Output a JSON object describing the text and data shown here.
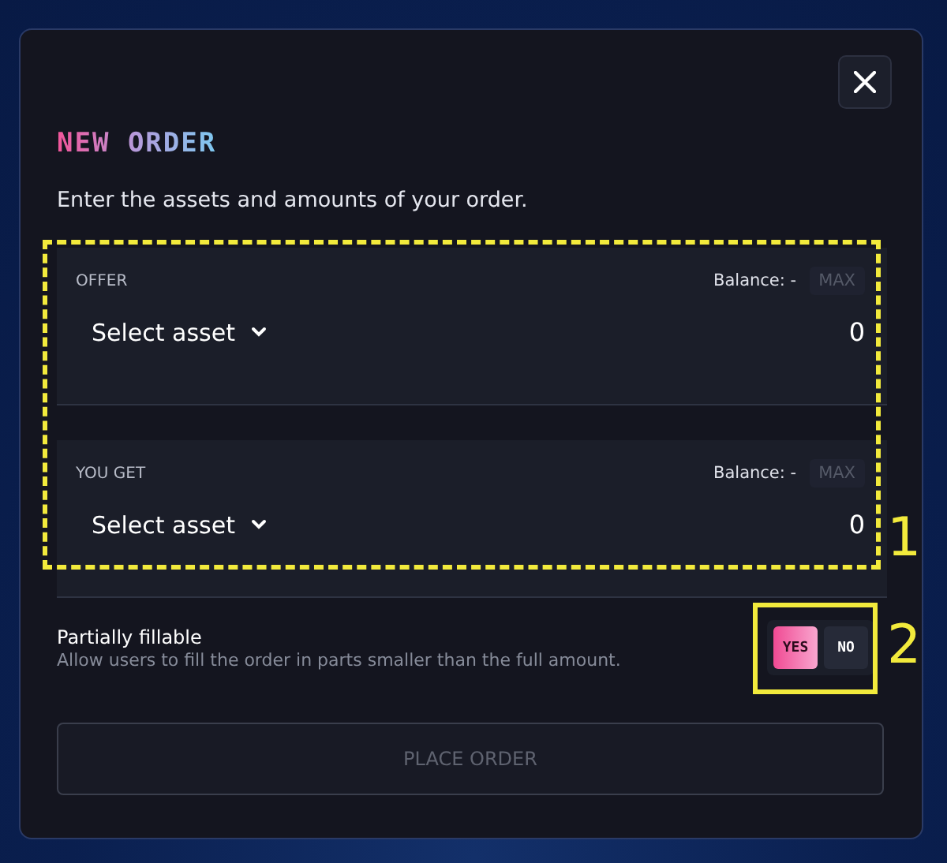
{
  "dialog": {
    "title": "NEW ORDER",
    "subtitle": "Enter the assets and amounts of your order."
  },
  "legs": [
    {
      "label": "OFFER",
      "balance": "Balance: -",
      "max": "MAX",
      "asset": "Select asset",
      "amount": "0"
    },
    {
      "label": "YOU GET",
      "balance": "Balance: -",
      "max": "MAX",
      "asset": "Select asset",
      "amount": "0"
    }
  ],
  "partial": {
    "label": "Partially fillable",
    "description": "Allow users to fill the order in parts smaller than the full amount.",
    "options": [
      {
        "label": "YES",
        "selected": true
      },
      {
        "label": "NO",
        "selected": false
      }
    ]
  },
  "submit": {
    "label": "PLACE ORDER",
    "disabled": true
  },
  "annotations": [
    "1",
    "2"
  ]
}
